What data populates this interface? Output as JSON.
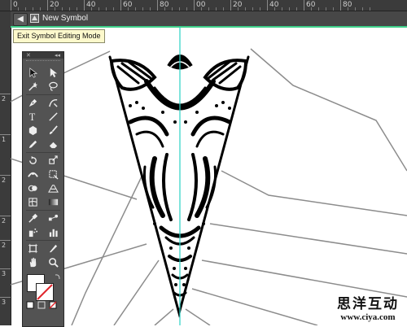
{
  "ruler": {
    "top_labels": [
      "0",
      "20",
      "40",
      "60",
      "80",
      "00",
      "20",
      "40",
      "60",
      "80"
    ],
    "left_labels": [
      "2",
      "1",
      "2",
      "2",
      "2",
      "3",
      "3"
    ]
  },
  "isolation_bar": {
    "back_glyph": "◀",
    "symbol_name": "New Symbol",
    "accent": "#3fd08a"
  },
  "tooltip": {
    "text": "Exit Symbol Editing Mode"
  },
  "toolbar": {
    "header_close": "✕",
    "header_collapse": "◂◂",
    "tools": [
      [
        "selection-tool",
        "direct-selection-tool"
      ],
      [
        "magic-wand-tool",
        "lasso-tool"
      ],
      [
        "pen-tool",
        "curvature-tool"
      ],
      [
        "type-tool",
        "line-segment-tool"
      ],
      [
        "rectangle-tool",
        "paintbrush-tool"
      ],
      [
        "pencil-tool",
        "eraser-tool"
      ],
      [
        "rotate-tool",
        "scale-tool"
      ],
      [
        "width-tool",
        "free-transform-tool"
      ],
      [
        "shape-builder-tool",
        "perspective-grid-tool"
      ],
      [
        "mesh-tool",
        "gradient-tool"
      ],
      [
        "eyedropper-tool",
        "blend-tool"
      ],
      [
        "symbol-sprayer-tool",
        "column-graph-tool"
      ],
      [
        "artboard-tool",
        "slice-tool"
      ],
      [
        "hand-tool",
        "zoom-tool"
      ]
    ]
  },
  "colors": {
    "fill": "#ffffff",
    "stroke": "#ffffff",
    "none_slash": "#e0262c"
  },
  "watermark": {
    "chinese": "思洋互动",
    "url": "www.ciya.com"
  }
}
